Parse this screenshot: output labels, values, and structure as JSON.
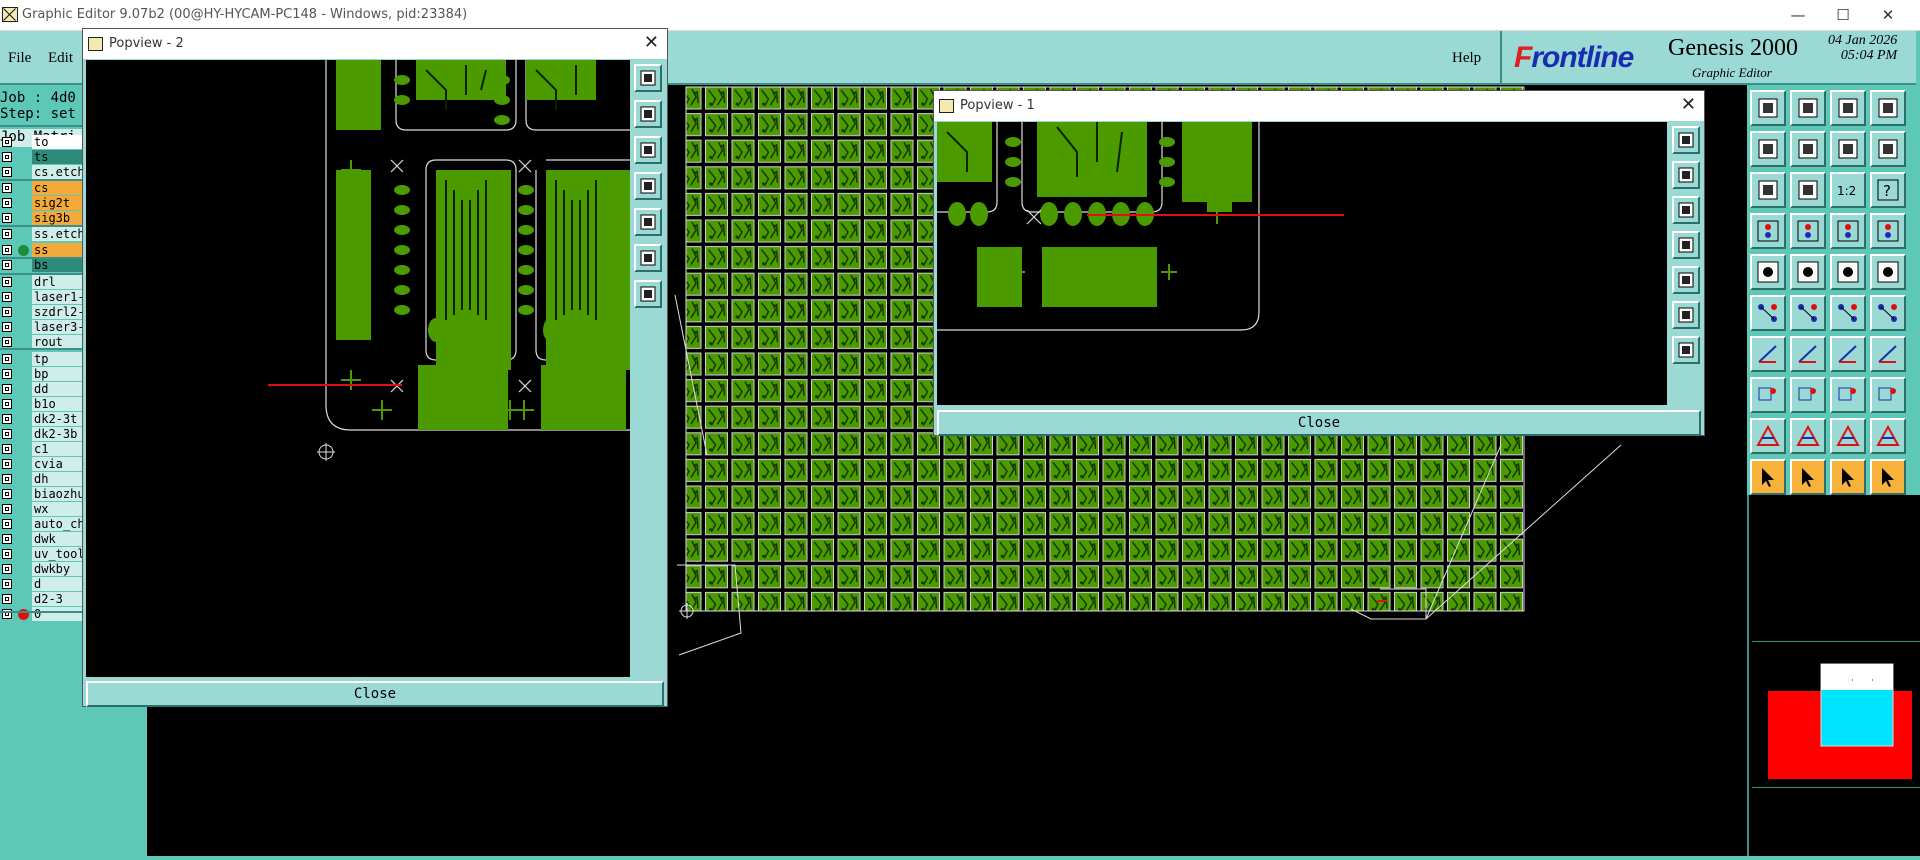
{
  "window": {
    "title": "Graphic Editor 9.07b2 (00@HY-HYCAM-PC148 - Windows, pid:23384)",
    "minimize": "—",
    "maximize": "☐",
    "close": "✕"
  },
  "menu": {
    "file": "File",
    "edit": "Edit",
    "help": "Help"
  },
  "brand": {
    "logo_first": "F",
    "logo_rest": "rontline",
    "product": "Genesis 2000",
    "subtitle": "Graphic Editor",
    "date": "04 Jan 2026",
    "time": "05:04 PM"
  },
  "job": {
    "job_line": "Job : 4d0",
    "step_line": "Step: set",
    "matrix_label": "Job Matri"
  },
  "layers": [
    {
      "name": "to",
      "bg": "#ffffff"
    },
    {
      "name": "ts",
      "bg": "#2e8b7a"
    },
    {
      "name": "cs.etch",
      "bg": "#cfeeea"
    },
    {
      "name": "cs",
      "bg": "#f4a93b"
    },
    {
      "name": "sig2t",
      "bg": "#f4a93b"
    },
    {
      "name": "sig3b",
      "bg": "#f4a93b"
    },
    {
      "name": "ss.etch",
      "bg": "#cfeeea"
    },
    {
      "name": "ss",
      "bg": "#f4a93b",
      "dot": "#1f8b3a"
    },
    {
      "name": "bs",
      "bg": "#2e8b7a"
    },
    {
      "name": "drl",
      "bg": "#cfeeea"
    },
    {
      "name": "laser1-",
      "bg": "#cfeeea"
    },
    {
      "name": "szdrl2-",
      "bg": "#cfeeea"
    },
    {
      "name": "laser3-",
      "bg": "#cfeeea"
    },
    {
      "name": "rout",
      "bg": "#cfeeea"
    },
    {
      "name": "tp",
      "bg": "#cfeeea"
    },
    {
      "name": "bp",
      "bg": "#cfeeea"
    },
    {
      "name": "dd",
      "bg": "#cfeeea"
    },
    {
      "name": "b1o",
      "bg": "#cfeeea"
    },
    {
      "name": "dk2-3t",
      "bg": "#cfeeea"
    },
    {
      "name": "dk2-3b",
      "bg": "#cfeeea"
    },
    {
      "name": "c1",
      "bg": "#cfeeea"
    },
    {
      "name": "cvia",
      "bg": "#cfeeea"
    },
    {
      "name": "dh",
      "bg": "#cfeeea"
    },
    {
      "name": "biaozhu",
      "bg": "#cfeeea"
    },
    {
      "name": "wx",
      "bg": "#cfeeea"
    },
    {
      "name": "auto_ch",
      "bg": "#cfeeea"
    },
    {
      "name": "dwk",
      "bg": "#cfeeea"
    },
    {
      "name": "uv_tool",
      "bg": "#cfeeea"
    },
    {
      "name": "dwkby",
      "bg": "#cfeeea"
    },
    {
      "name": "d",
      "bg": "#cfeeea"
    },
    {
      "name": "d2-3",
      "bg": "#cfeeea"
    },
    {
      "name": "0",
      "bg": "#cfeeea",
      "dot": "#e01010"
    }
  ],
  "popview1": {
    "title": "Popview - 1",
    "close_x": "✕",
    "close_label": "Close"
  },
  "popview2": {
    "title": "Popview - 2",
    "close_x": "✕",
    "close_label": "Close"
  },
  "tool_labels": {
    "zoom_ratio": "1:2",
    "help": "?"
  },
  "colors": {
    "copper": "#4a9a00",
    "panel": "#9ad9d4",
    "background": "#5ec8b8",
    "highlight": "#f6b23a",
    "measure_line": "#e01010"
  }
}
